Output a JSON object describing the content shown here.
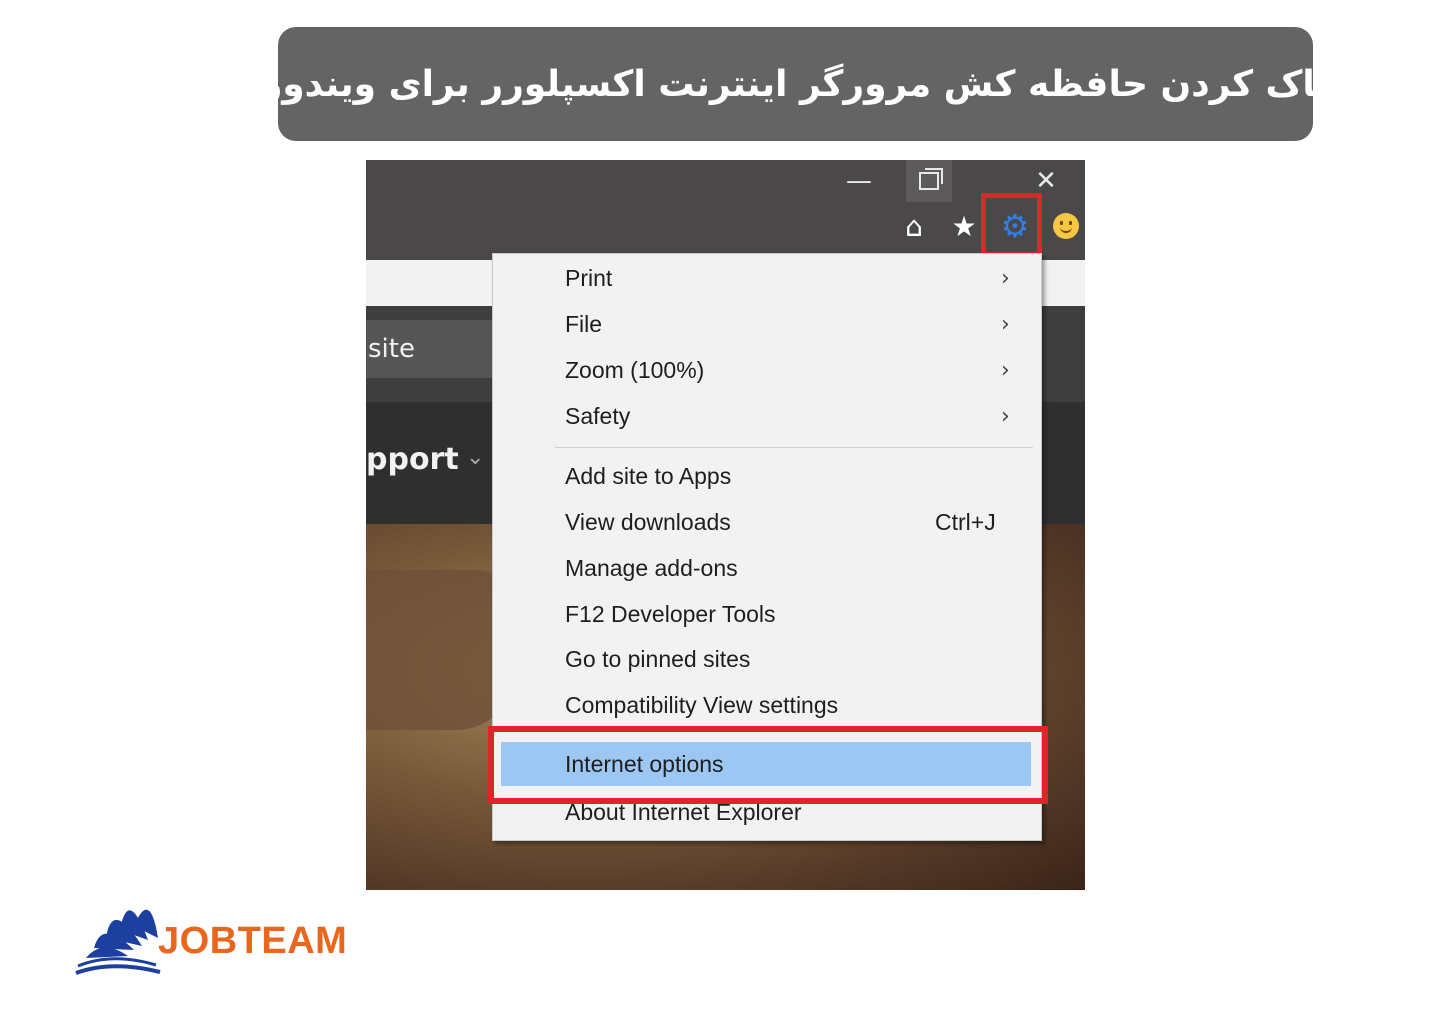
{
  "banner": {
    "title": "پاک کردن حافظه کش مرورگر اینترنت اکسپلورر  برای ویندوز"
  },
  "browser": {
    "window_controls": {
      "minimize": "—",
      "close": "✕"
    },
    "address_fragment": "site",
    "nav_fragment": "pport",
    "toolbar_icons": [
      "home-icon",
      "star-icon",
      "gear-icon",
      "smiley-icon"
    ]
  },
  "menu": {
    "items": [
      {
        "label": "Print",
        "arrow": "›"
      },
      {
        "label": "File",
        "arrow": "›"
      },
      {
        "label": "Zoom (100%)",
        "arrow": "›"
      },
      {
        "label": "Safety",
        "arrow": "›"
      },
      {
        "label": "Add site to Apps"
      },
      {
        "label": "View downloads",
        "shortcut": "Ctrl+J"
      },
      {
        "label": "Manage add-ons"
      },
      {
        "label": "F12 Developer Tools"
      },
      {
        "label": "Go to pinned sites"
      },
      {
        "label": "Compatibility View settings"
      },
      {
        "label": "Internet options",
        "selected": true
      },
      {
        "label": "About Internet Explorer"
      }
    ]
  },
  "logo": {
    "text": "JOBTEAM"
  },
  "colors": {
    "highlight_red": "#e0252a",
    "selected_blue": "#9bc7f2",
    "banner_gray": "#646464",
    "logo_orange": "#e9661f",
    "logo_blue": "#1d3fa0"
  }
}
